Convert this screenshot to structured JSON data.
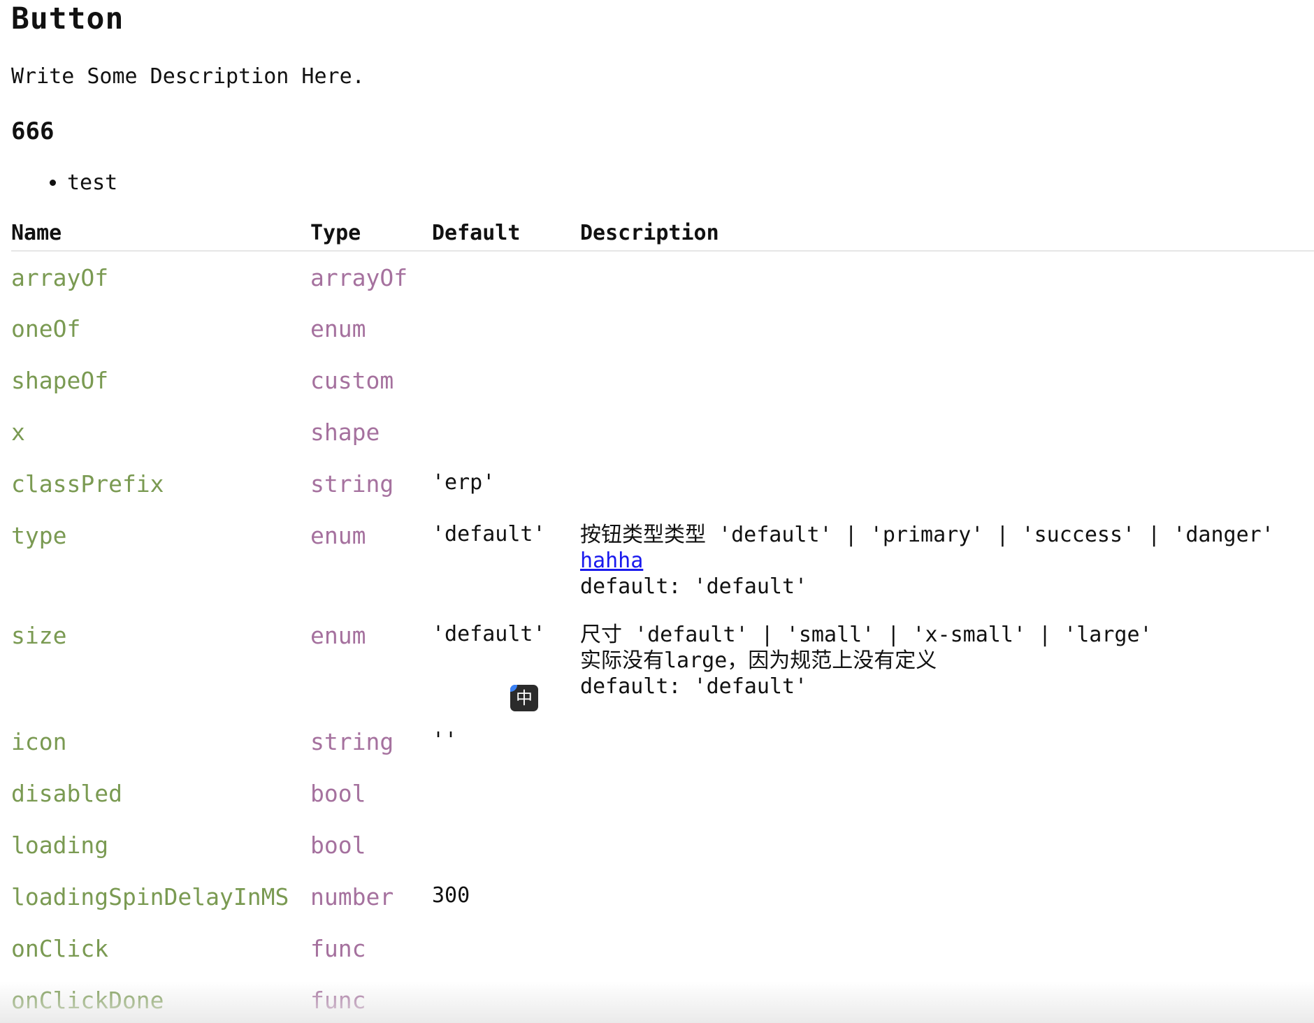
{
  "title": "Button",
  "description": "Write Some Description Here.",
  "subheading": "666",
  "list_items": [
    "test"
  ],
  "table": {
    "headers": {
      "name": "Name",
      "type": "Type",
      "default": "Default",
      "description": "Description"
    },
    "rows": [
      {
        "name": "arrayOf",
        "type": "arrayOf",
        "default": "",
        "desc": []
      },
      {
        "name": "oneOf",
        "type": "enum",
        "default": "",
        "desc": []
      },
      {
        "name": "shapeOf",
        "type": "custom",
        "default": "",
        "desc": []
      },
      {
        "name": "x",
        "type": "shape",
        "default": "",
        "desc": []
      },
      {
        "name": "classPrefix",
        "type": "string",
        "default": "'erp'",
        "desc": []
      },
      {
        "name": "type",
        "type": "enum",
        "default": "'default'",
        "desc": [
          "按钮类型类型 'default' | 'primary' | 'success' | 'danger'",
          "hahha",
          "default: 'default'"
        ]
      },
      {
        "name": "size",
        "type": "enum",
        "default": "'default'",
        "desc": [
          "尺寸 'default' | 'small' | 'x-small' | 'large'",
          "实际没有large，因为规范上没有定义",
          "default: 'default'"
        ]
      },
      {
        "name": "icon",
        "type": "string",
        "default": "''",
        "desc": []
      },
      {
        "name": "disabled",
        "type": "bool",
        "default": "",
        "desc": []
      },
      {
        "name": "loading",
        "type": "bool",
        "default": "",
        "desc": []
      },
      {
        "name": "loadingSpinDelayInMS",
        "type": "number",
        "default": "300",
        "desc": []
      },
      {
        "name": "onClick",
        "type": "func",
        "default": "",
        "desc": []
      },
      {
        "name": "onClickDone",
        "type": "func",
        "default": "",
        "desc": []
      }
    ]
  },
  "ime_indicator": {
    "label": "中",
    "accent_color": "#3b82f6"
  },
  "colors": {
    "name": "#7a9a52",
    "type": "#a5719e",
    "link": "#1a1aee"
  }
}
